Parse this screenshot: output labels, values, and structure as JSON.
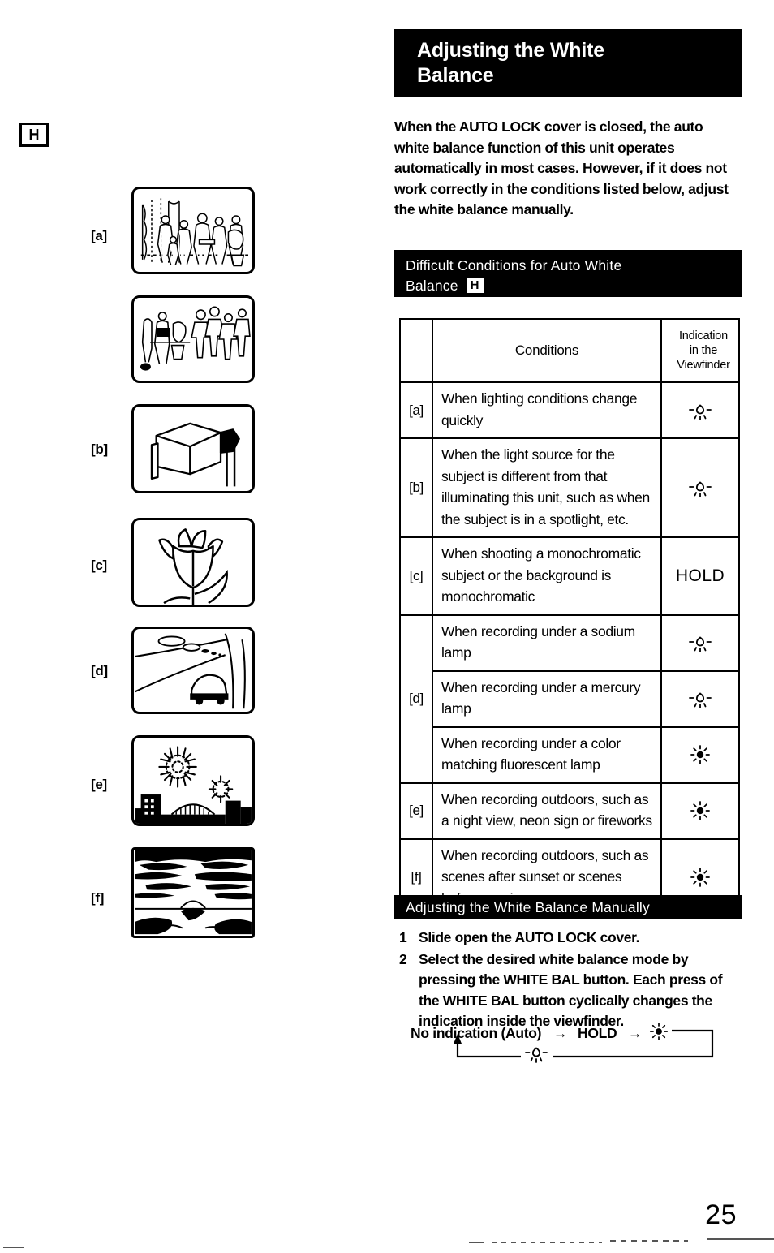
{
  "page": {
    "number": "25",
    "ref_badge": "H"
  },
  "heading": {
    "title_line1": "Adjusting the White",
    "title_line2": "Balance"
  },
  "intro": "When the AUTO LOCK cover is closed, the auto white balance function of this unit operates automatically in most cases. However, if it does not work correctly in the conditions listed below, adjust the white balance manually.",
  "conditions_section": {
    "bar_line1": "Difficult Conditions for Auto White",
    "bar_line2": "Balance",
    "bar_badge": "H"
  },
  "table": {
    "headers": {
      "key": "",
      "conditions": "Conditions",
      "indication": "Indication in the Viewfinder",
      "indication_line1": "Indication",
      "indication_line2": "in the",
      "indication_line3": "Viewfinder"
    },
    "rows": [
      {
        "key": "[a]",
        "condition": "When lighting conditions change quickly",
        "indication_icon": "bulb-icon",
        "indication_text": ""
      },
      {
        "key": "[b]",
        "condition": "When the light source for the subject is different from that illuminating this unit, such as when the subject is in a spotlight, etc.",
        "indication_icon": "bulb-icon",
        "indication_text": ""
      },
      {
        "key": "[c]",
        "condition": "When shooting a monochromatic subject or the background is monochromatic",
        "indication_icon": "",
        "indication_text": "HOLD"
      },
      {
        "key": "[d]",
        "condition": "When recording under a sodium lamp",
        "indication_icon": "bulb-icon",
        "indication_text": ""
      },
      {
        "key": "",
        "condition": "When recording under a mercury lamp",
        "indication_icon": "bulb-icon",
        "indication_text": ""
      },
      {
        "key": "",
        "condition": "When recording under a color matching fluorescent lamp",
        "indication_icon": "sun-icon",
        "indication_text": ""
      },
      {
        "key": "[e]",
        "condition": "When recording outdoors, such as a night view, neon sign or fireworks",
        "indication_icon": "sun-icon",
        "indication_text": ""
      },
      {
        "key": "[f]",
        "condition": "When recording outdoors, such as scenes after sunset or scenes before sunrise.",
        "indication_icon": "sun-icon",
        "indication_text": ""
      }
    ]
  },
  "manual_section": {
    "bar_title": "Adjusting the White Balance Manually",
    "steps": [
      {
        "num": "1",
        "text": "Slide open the AUTO LOCK cover."
      },
      {
        "num": "2",
        "text": "Select the desired white balance mode by pressing the WHITE BAL button. Each press of the WHITE BAL button cyclically changes the indication inside the viewfinder."
      }
    ],
    "cycle": {
      "item1": "No indication (Auto)",
      "arrow1": "→",
      "item2": "HOLD",
      "arrow2": "→",
      "item3_icon": "sun-icon",
      "item4_icon": "bulb-icon"
    }
  },
  "figures": [
    {
      "key": "[a]",
      "caption_icon": "crowd-indoor-scene"
    },
    {
      "key": "",
      "caption_icon": "crowd-outdoor-scene"
    },
    {
      "key": "[b]",
      "caption_icon": "spotlight-scene"
    },
    {
      "key": "[c]",
      "caption_icon": "tulip-flower-scene"
    },
    {
      "key": "[d]",
      "caption_icon": "road-sodium-lamp-scene"
    },
    {
      "key": "[e]",
      "caption_icon": "fireworks-city-scene"
    },
    {
      "key": "[f]",
      "caption_icon": "sunset-sea-scene"
    }
  ]
}
